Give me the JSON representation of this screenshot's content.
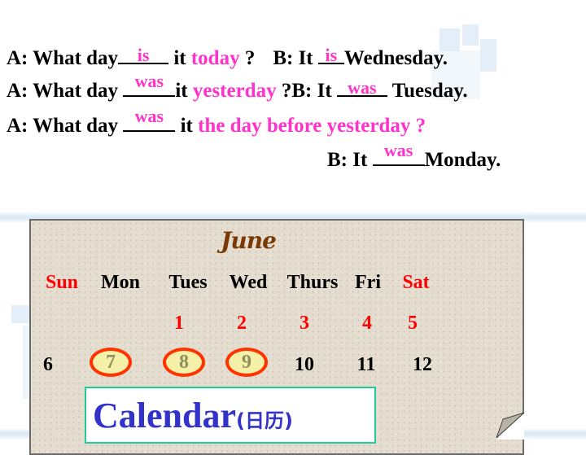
{
  "dialogue": {
    "line1": {
      "a_prefix": "A: What day",
      "a_answer": "is",
      "a_mid": " it ",
      "a_time": "today",
      "a_q": " ?",
      "b_prefix": "B: It ",
      "b_answer": "is",
      "b_day": "Wednesday."
    },
    "line2": {
      "a_prefix": "A: What day ",
      "a_answer": "was",
      "a_mid": "it ",
      "a_time": "yesterday",
      "a_q": " ?",
      "b_prefix": "B: It ",
      "b_answer": "was",
      "b_day": " Tuesday."
    },
    "line3": {
      "a_prefix": "A: What day ",
      "a_answer": "was",
      "a_mid": " it ",
      "a_time": "the day before yesterday",
      "a_q": " ?"
    },
    "line4": {
      "b_prefix": "B: It ",
      "b_answer": "was",
      "b_day": "Monday."
    }
  },
  "calendar": {
    "month": "June",
    "weekdays": [
      "Sun",
      "Mon",
      "Tues",
      "Wed",
      "Thurs",
      "Fri",
      "Sat"
    ],
    "week1": [
      "",
      "",
      "1",
      "2",
      "3",
      "4",
      "5"
    ],
    "week2": [
      "6",
      "7",
      "8",
      "9",
      "10",
      "11",
      "12"
    ],
    "circled_days": [
      "7",
      "8",
      "9"
    ],
    "colors": {
      "weekend": "#ff0000",
      "first_week": "#ff0000",
      "circle": "#ff3300",
      "month": "#7a3a06"
    }
  },
  "label": {
    "english": "Calendar",
    "chinese": "(日历)"
  },
  "colors": {
    "answer": "#ff33cc",
    "label_text": "#3333cc",
    "label_border": "#22cc99"
  }
}
